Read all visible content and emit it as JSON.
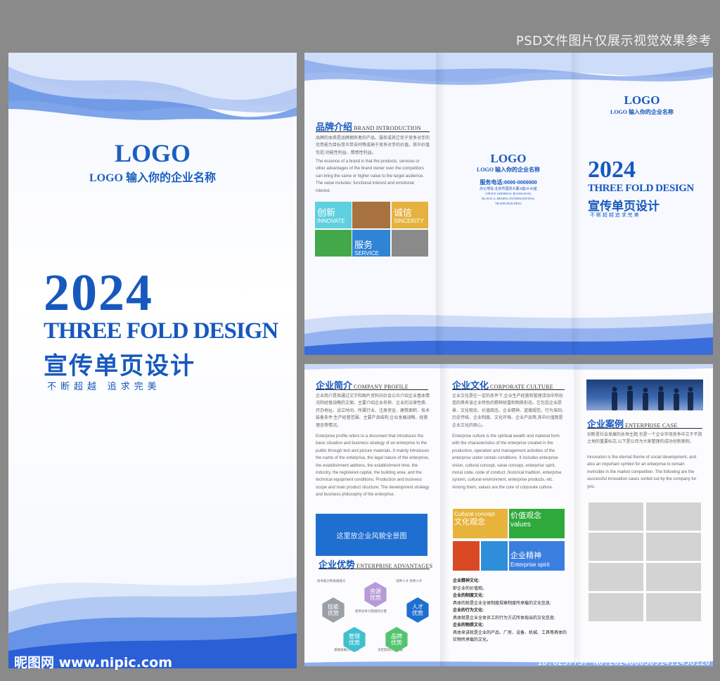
{
  "watermark": {
    "top": "PSD文件图片仅展示视觉效果参考",
    "site": "昵图网 www.nipic.com",
    "id": "ID:6237737 NO:20240605091411458120"
  },
  "colors": {
    "brand_blue": "#1758bd",
    "background_gray": "#8a8a8a"
  },
  "cover": {
    "logo": "LOGO",
    "company": "LOGO 输入你的企业名称",
    "year": "2024",
    "title_en": "THREE FOLD DESIGN",
    "title_cn": "宣传单页设计",
    "slogan": "不断超越   追求完美"
  },
  "outside": {
    "brand": {
      "title_cn": "品牌介绍",
      "title_en": "BRAND INTRODUCTION",
      "para_cn": "品牌的本质是品牌拥有者的产品、服务或其它优于竞争对手的优势能为目标受众带去同等或高于竞争对手的价值。其中价值包括:功能性利益、情感性利益。",
      "para_en": "The essence of a brand is that the products, services or other advantages of the brand owner over the competitors can bring the same or higher value to the target audience. The value includes: functional interest and emotional interest.",
      "tiles": [
        {
          "cn": "创新",
          "en": "INNOVATE",
          "color": "#5fd0df"
        },
        {
          "cn": "",
          "en": "",
          "color": "#a8733f"
        },
        {
          "cn": "诚信",
          "en": "SINCERITY",
          "color": "#e5b23e"
        },
        {
          "cn": "",
          "en": "",
          "color": "#43a849"
        },
        {
          "cn": "服务",
          "en": "SERVICE",
          "color": "#2f84d6"
        },
        {
          "cn": "",
          "en": "",
          "color": "#8a8a8a"
        }
      ]
    },
    "back": {
      "logo": "LOGO",
      "company": "LOGO 输入你的企业名称",
      "phone": "服务电话:0000-0000000",
      "address": "办公地址:北京市国贸大厦A座28-08室",
      "address_en_1": "OFFICE ADDRESS: ROOM 28-08,",
      "address_en_2": "BLOCK A, BEIJING INTERNATIONAL",
      "address_en_3": "TRADE BUILDING"
    },
    "front": {
      "logo": "LOGO",
      "company": "LOGO 输入你的企业名称",
      "year": "2024",
      "title_en": "THREE FOLD DESIGN",
      "title_cn": "宣传单页设计",
      "slogan": "不 断 超 越   追 求 完 美"
    }
  },
  "inside": {
    "profile": {
      "title_cn": "企业简介",
      "title_en": "COMPANY PROFILE",
      "para_cn": "企业简介是指通过文字和图片资料向社会公众介绍企业基本情况和经营战略的文案。主要介绍企业名称、企业的法律性质、开办地址、设立时间、所属行业、注册资金、建筑面积、技术装备条件;生产经营范围、主要产品结构;企业发展战略、经营理念等情况。",
      "para_en": "Enterprise profile refers to a document that introduces the basic situation and business strategy of an enterprise to the public through text and picture materials. It mainly introduces the name of the enterprise, the legal nature of the enterprise, the establishment address, the establishment time, the industry, the registered capital, the building area, and the technical equipment conditions; Production and business scope and main product structure; The development strategy and business philosophy of the enterprise.",
      "image_placeholder": "这里放企业风貌全景图"
    },
    "advantages": {
      "title_cn": "企业优势",
      "title_en": "ENTERPRISE ADVANTAGES",
      "note_tl": "技术能力和发展能力",
      "note_tr": "培养人才 优秀人才",
      "note_mid": "提供竞争力基础的力量",
      "note_bl": "基础发展力的优势",
      "note_br": "决定影响力的力量",
      "hexes": [
        {
          "label": "技能\n优势",
          "color": "#9aa0a8"
        },
        {
          "label": "资源\n优势",
          "color": "#b79ad8"
        },
        {
          "label": "人才\n优势",
          "color": "#1f6fd0"
        },
        {
          "label": "管理\n优势",
          "color": "#3fc0cf"
        },
        {
          "label": "品牌\n优势",
          "color": "#55c46e"
        }
      ]
    },
    "culture": {
      "title_cn": "企业文化",
      "title_en": "CORPORATE CULTURE",
      "para_cn": "企业文化是在一定的条件下,企业生产经营和管理活动中所创造的具有该企业特色的精神财富和物质形态。它包括企业愿景、文化观念、价值观念、企业精神、道德规范、行为准则、历史传统、企业制度、文化环境、企业产品等,其中价值观是企业文化的核心。",
      "para_en": "Enterprise culture is the spiritual wealth and material form with the characteristics of the enterprise created in the production, operation and management activities of the enterprise under certain conditions. It includes enterprise vision, cultural concept, value concept, enterprise spirit, moral code, code of conduct, historical tradition, enterprise system, cultural environment, enterprise products, etc. Among them, values are the core of corporate culture.",
      "tiles": [
        {
          "cn": "文化观念",
          "en": "Cultural concept",
          "color": "#e8b33a"
        },
        {
          "cn": "价值观念",
          "en": "values",
          "color": "#2eaa3b"
        },
        {
          "cn": "",
          "en": "",
          "color": "#d94a24"
        },
        {
          "cn": "",
          "en": "",
          "color": "#2f8ed9"
        },
        {
          "cn": "企业精神",
          "en": "Enterprise spirit",
          "color": "#3a7fe0"
        }
      ],
      "list": [
        {
          "head": "企业精神文化:",
          "text": "即企业的价值观。"
        },
        {
          "head": "企业的制度文化:",
          "text": "具体的就是企业全体制度规章制度所承载的文化信息;"
        },
        {
          "head": "企业的行为文化:",
          "text": "具体就是企业全体员工的行为方式所体现出的文化信息;"
        },
        {
          "head": "企业的物质文化:",
          "text": "具体来讲就是企业的产品、厂房、设备、机械、工具等具体的实物所承载的文化。"
        }
      ]
    },
    "cases": {
      "title_cn": "企业案例",
      "title_en": "ENTERPRISE CASE",
      "para_cn": "创新是社会发展的永恒主题,也是一个企业市场竞争中立于不败之地的重要标志,以下是公司为大家整理的成功创新案例。",
      "para_en": "Innovation is the eternal theme of social development, and also an important symbol for an enterprise to remain invincible in the market competition. The following are the successful innovation cases sorted out by the company for you."
    }
  }
}
